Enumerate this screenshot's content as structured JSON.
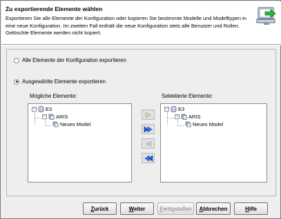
{
  "header": {
    "title": "Zu exportierende Elemente wählen",
    "description": "Exportieren Sie alle Elemente der Konfiguration oder kopieren Sie bestimmte Modelle und Modelltypen in eine neue Konfiguration. Im zweiten Fall enthält die neue Konfiguration stets alle Benutzer und Rollen. Gelöschte Elemente werden nicht kopiert.",
    "icon": "export-config-icon"
  },
  "options": {
    "export_all": {
      "label": "Alle Elemente der Konfiguration exportieren",
      "checked": false
    },
    "export_selected": {
      "label": "Ausgewählte Elemente exportieren",
      "checked": true
    }
  },
  "available": {
    "label": "Mögliche Elemente:",
    "tree": [
      {
        "label": "E3",
        "icon": "database-icon"
      },
      {
        "label": "ARIS",
        "icon": "group-icon"
      },
      {
        "label": "Neues Model",
        "icon": "model-icon"
      }
    ]
  },
  "selected": {
    "label": "Selektierte Elemente:",
    "tree": [
      {
        "label": "E3",
        "icon": "database-icon"
      },
      {
        "label": "ARIS",
        "icon": "group-icon"
      },
      {
        "label": "Neues Model",
        "icon": "model-icon"
      }
    ]
  },
  "move_buttons": [
    {
      "icon": "move-right-icon",
      "enabled": false
    },
    {
      "icon": "move-all-right-icon",
      "enabled": true
    },
    {
      "icon": "move-left-icon",
      "enabled": false
    },
    {
      "icon": "move-all-left-icon",
      "enabled": true
    }
  ],
  "buttons": {
    "back": "Zurück",
    "next": "Weiter",
    "finish": "Fertigstellen",
    "cancel": "Abbrechen",
    "help": "Hilfe"
  },
  "colors": {
    "accent_arrow": "#1e5bd6",
    "disabled_arrow": "#c8c8c8"
  }
}
